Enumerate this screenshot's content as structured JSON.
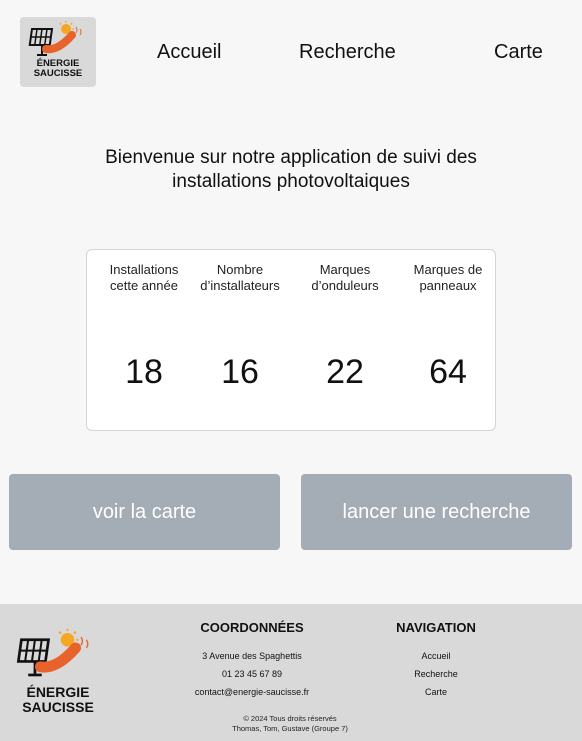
{
  "header": {
    "logo": {
      "line1": "ÉNERGIE",
      "line2": "SAUCISSE"
    },
    "nav": [
      "Accueil",
      "Recherche",
      "Carte"
    ]
  },
  "welcome": "Bienvenue sur notre application de suivi des installations photovoltaiques",
  "stats": [
    {
      "label": "Installations cette année",
      "value": "18"
    },
    {
      "label": "Nombre d’installateurs",
      "value": "16"
    },
    {
      "label": "Marques d’onduleurs",
      "value": "22"
    },
    {
      "label": "Marques de panneaux",
      "value": "64"
    }
  ],
  "buttons": {
    "map": "voir la carte",
    "search": "lancer une recherche"
  },
  "footer": {
    "logo": {
      "line1": "ÉNERGIE",
      "line2": "SAUCISSE"
    },
    "contact": {
      "title": "COORDONNÉES",
      "address": "3 Avenue des Spaghettis",
      "phone": "01 23 45 67 89",
      "email": "contact@energie-saucisse.fr"
    },
    "navigation": {
      "title": "NAVIGATION",
      "links": [
        "Accueil",
        "Recherche",
        "Carte"
      ]
    },
    "copyright": "©  2024 Tous droits réservés",
    "authors": "Thomas, Tom, Gustave  (Groupe 7)"
  },
  "colors": {
    "button": "#a4acb5",
    "footer": "#d9d9d9",
    "sausage": "#e8632c",
    "sun": "#f5a623"
  }
}
